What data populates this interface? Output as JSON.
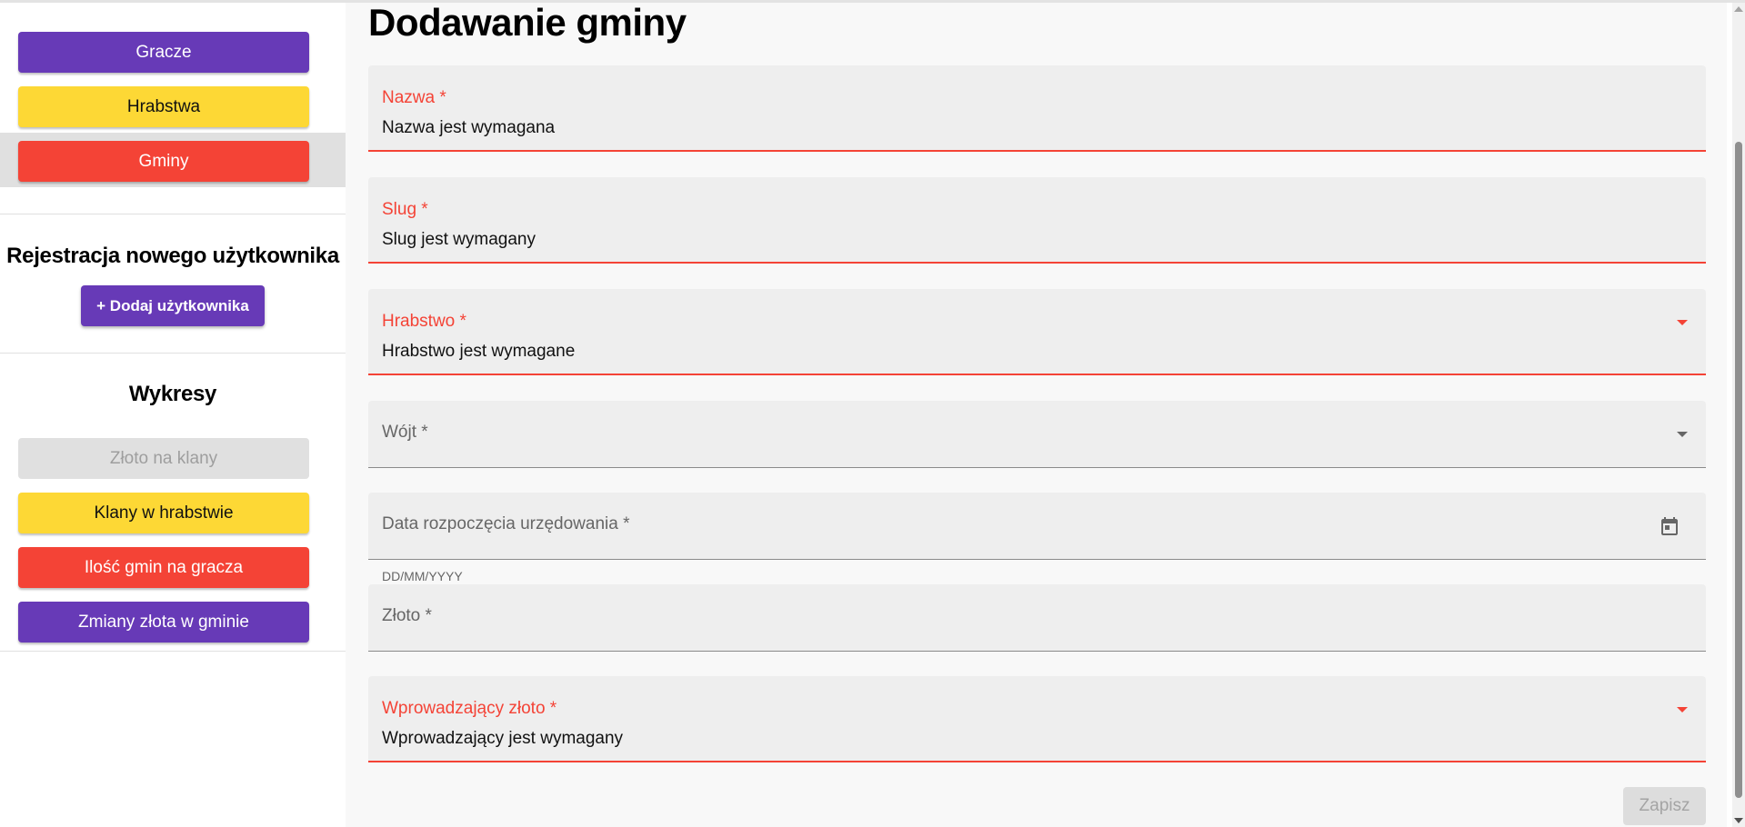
{
  "sidebar": {
    "nav": [
      {
        "label": "Gracze",
        "color": "#673ab7"
      },
      {
        "label": "Hrabstwa",
        "color": "#fdd835"
      },
      {
        "label": "Gminy",
        "color": "#f44336",
        "active": true
      }
    ],
    "register": {
      "title": "Rejestracja nowego użytkownika",
      "button": "+ Dodaj użytkownika"
    },
    "charts": {
      "title": "Wykresy",
      "items": [
        {
          "label": "Złoto na klany",
          "state": "disabled"
        },
        {
          "label": "Klany w hrabstwie",
          "color": "#fdd835"
        },
        {
          "label": "Ilość gmin na gracza",
          "color": "#f44336"
        },
        {
          "label": "Zmiany złota w gminie",
          "color": "#673ab7"
        }
      ]
    }
  },
  "main": {
    "title": "Dodawanie gminy",
    "fields": {
      "nazwa": {
        "label": "Nazwa *",
        "value": "Nazwa jest wymagana"
      },
      "slug": {
        "label": "Slug *",
        "value": "Slug jest wymagany"
      },
      "hrabstwo": {
        "label": "Hrabstwo *",
        "value": "Hrabstwo jest wymagane"
      },
      "wojt": {
        "label": "Wójt *"
      },
      "data": {
        "label": "Data rozpoczęcia urzędowania *",
        "hint": "DD/MM/YYYY"
      },
      "zloto": {
        "label": "Złoto *"
      },
      "wprowadzajacy": {
        "label": "Wprowadzający złoto *",
        "value": "Wprowadzający jest wymagany"
      }
    },
    "save_label": "Zapisz"
  },
  "colors": {
    "accent_purple": "#673ab7",
    "accent_yellow": "#fdd835",
    "error_red": "#f44336"
  }
}
